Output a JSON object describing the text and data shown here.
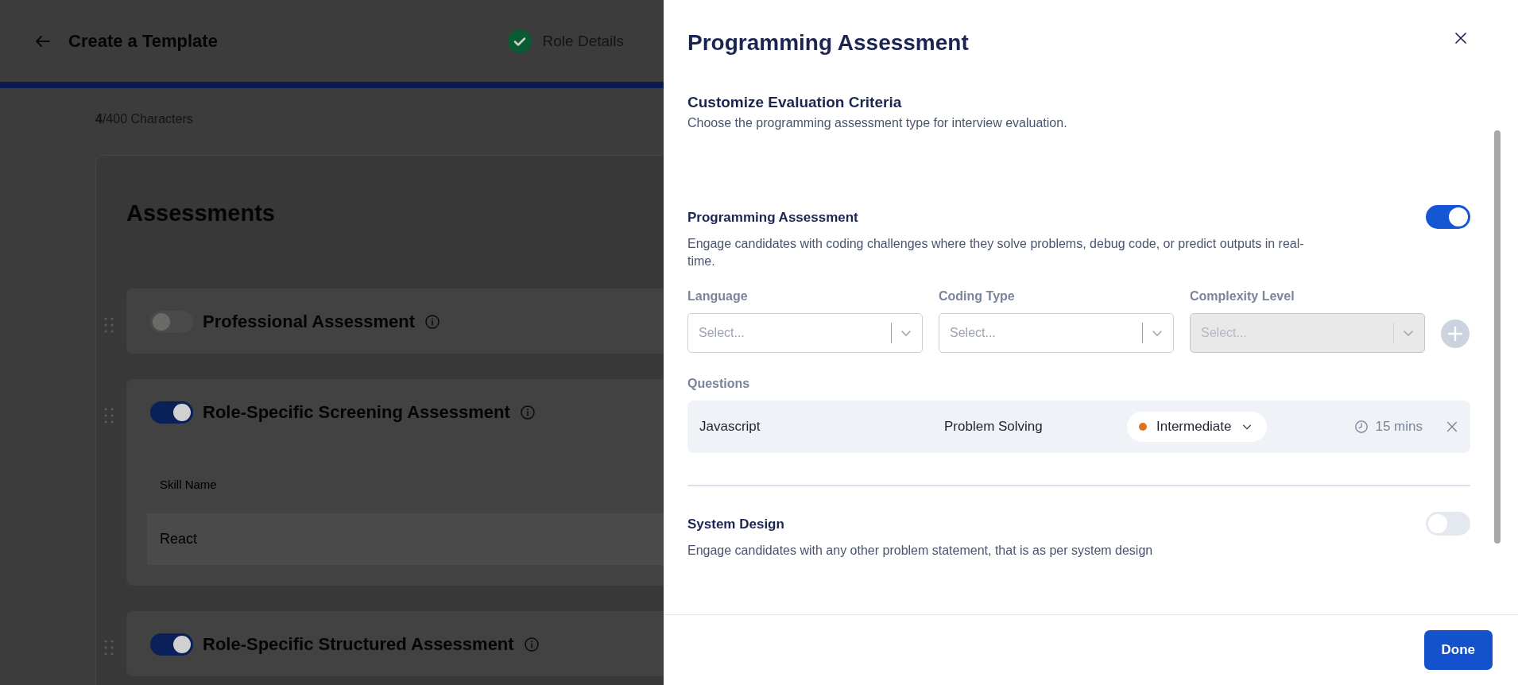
{
  "page": {
    "title": "Create a Template",
    "steps": [
      {
        "label": "Role Details",
        "done": true
      }
    ],
    "char_count": "**4**/400 Characters",
    "assessments_title": "Assessments",
    "assessments": [
      {
        "title": "Professional Assessment",
        "on": false,
        "kind": "plain"
      },
      {
        "title": "Role-Specific Screening Assessment",
        "on": true,
        "kind": "skills",
        "skill_label": "Skill Name",
        "skill_value": "React"
      },
      {
        "title": "Role-Specific Structured Assessment",
        "on": true,
        "kind": "plain"
      }
    ]
  },
  "drawer": {
    "title": "Programming Assessment",
    "subtitle": "Customize Evaluation Criteria",
    "description": "Choose the programming assessment type for interview evaluation.",
    "sections": [
      {
        "kind": "configurable",
        "title": "Programming Assessment",
        "description": "Engage candidates with coding challenges where they solve problems, debug code, or predict outputs in real-time.",
        "on": true,
        "fields": [
          {
            "label": "Language",
            "placeholder": "Select...",
            "disabled": false
          },
          {
            "label": "Coding Type",
            "placeholder": "Select...",
            "disabled": false
          },
          {
            "label": "Complexity Level",
            "placeholder": "Select...",
            "disabled": true
          }
        ],
        "questions_label": "Questions",
        "questions": [
          {
            "language": "Javascript",
            "type": "Problem Solving",
            "level": "Intermediate",
            "color": "#e0731f",
            "duration": "15 mins"
          }
        ]
      },
      {
        "kind": "simple",
        "title": "System Design",
        "description": "Engage candidates with any other problem statement, that is as per system design",
        "on": false
      }
    ],
    "done": "Done"
  }
}
